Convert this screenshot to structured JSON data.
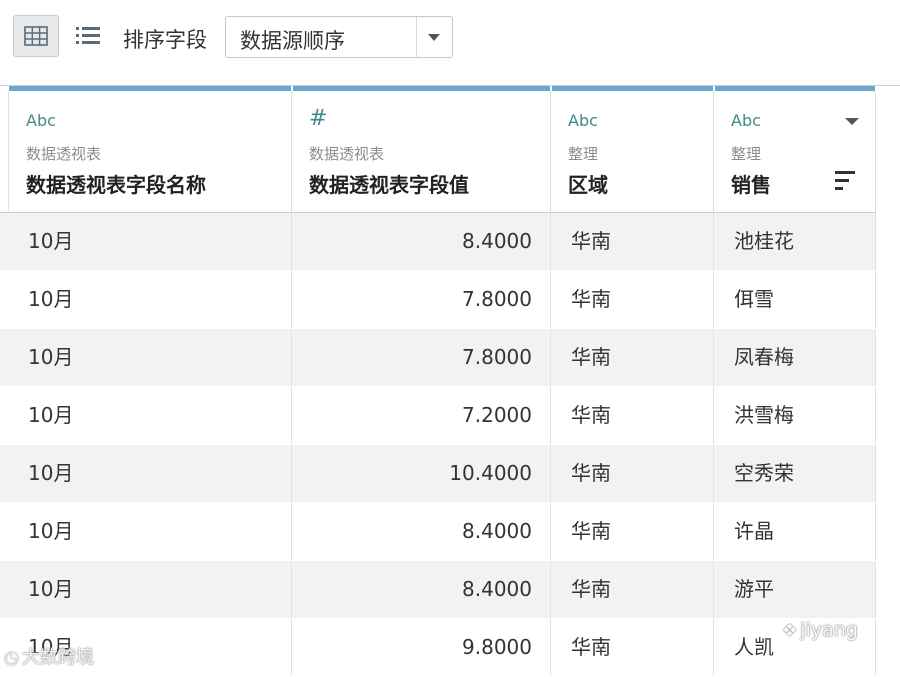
{
  "toolbar": {
    "grid_view_icon": "grid-view-icon",
    "list_view_icon": "list-view-icon",
    "sort_label": "排序字段",
    "sort_value": "数据源顺序"
  },
  "columns": [
    {
      "type": "Abc",
      "source": "数据透视表",
      "name": "数据透视表字段名称"
    },
    {
      "type": "#",
      "source": "数据透视表",
      "name": "数据透视表字段值"
    },
    {
      "type": "Abc",
      "source": "整理",
      "name": "区域"
    },
    {
      "type": "Abc",
      "source": "整理",
      "name": "销售"
    }
  ],
  "rows": [
    {
      "c1": "10月",
      "c2": "8.4000",
      "c3": "华南",
      "c4": "池桂花"
    },
    {
      "c1": "10月",
      "c2": "7.8000",
      "c3": "华南",
      "c4": "佴雪"
    },
    {
      "c1": "10月",
      "c2": "7.8000",
      "c3": "华南",
      "c4": "凤春梅"
    },
    {
      "c1": "10月",
      "c2": "7.2000",
      "c3": "华南",
      "c4": "洪雪梅"
    },
    {
      "c1": "10月",
      "c2": "10.4000",
      "c3": "华南",
      "c4": "空秀荣"
    },
    {
      "c1": "10月",
      "c2": "8.4000",
      "c3": "华南",
      "c4": "许晶"
    },
    {
      "c1": "10月",
      "c2": "8.4000",
      "c3": "华南",
      "c4": "游平"
    },
    {
      "c1": "10月",
      "c2": "9.8000",
      "c3": "华南",
      "c4": "人凯"
    }
  ],
  "colors": {
    "accent": "#6aa7cf",
    "type_icon": "#3f8b8b"
  },
  "watermarks": {
    "left": "大数跨境",
    "right": "jiyang"
  }
}
